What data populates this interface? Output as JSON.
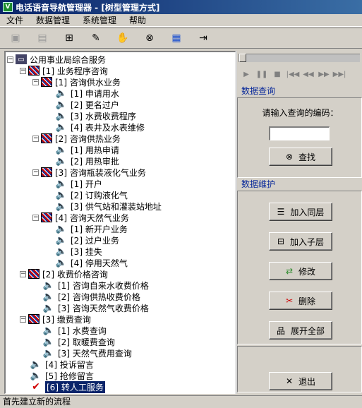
{
  "window": {
    "title": "电话语音导航管理器 - [树型管理方式]"
  },
  "menu": [
    {
      "label": "文件"
    },
    {
      "label": "数据管理"
    },
    {
      "label": "系统管理"
    },
    {
      "label": "帮助"
    }
  ],
  "toolbar": {
    "icons": [
      "save-icon",
      "copy-icon",
      "tree-icon",
      "edit-icon",
      "hand-icon",
      "binoculars-icon",
      "grid-icon",
      "exit-icon"
    ]
  },
  "tree": {
    "root": "公用事业局综合服务",
    "n1": "[1] 业务程序咨询",
    "n1_1": "[1] 咨询供水业务",
    "n1_1_1": "[1] 申请用水",
    "n1_1_2": "[2] 更名过户",
    "n1_1_3": "[3] 水费收费程序",
    "n1_1_4": "[4] 表井及水表维修",
    "n1_2": "[2] 咨询供热业务",
    "n1_2_1": "[1] 用热申请",
    "n1_2_2": "[2] 用热审批",
    "n1_3": "[3] 咨询瓶装液化气业务",
    "n1_3_1": "[1] 开户",
    "n1_3_2": "[2] 订购液化气",
    "n1_3_3": "[3] 供气站和灌装站地址",
    "n1_4": "[4] 咨询天然气业务",
    "n1_4_1": "[1] 新开户业务",
    "n1_4_2": "[2] 过户业务",
    "n1_4_3": "[3] 挂失",
    "n1_4_4": "[4] 停用天然气",
    "n2": "[2] 收费价格咨询",
    "n2_1": "[1] 咨询自来水收费价格",
    "n2_2": "[2] 咨询供热收费价格",
    "n2_3": "[3] 咨询天然气收费价格",
    "n3": "[3] 缴费查询",
    "n3_1": "[1] 水费查询",
    "n3_2": "[2] 取暖费查询",
    "n3_3": "[3] 天然气费用查询",
    "n4": "[4] 投诉留言",
    "n5": "[5] 抢修留言",
    "n6": "[6] 转人工服务"
  },
  "query": {
    "section_title": "数据查询",
    "prompt": "请输入查询的编码：",
    "input_value": "",
    "find_label": "查找"
  },
  "maintain": {
    "section_title": "数据维护",
    "add_sibling": "加入同层",
    "add_child": "加入子层",
    "modify": "修改",
    "delete": "删除",
    "expand_all": "展开全部"
  },
  "exit_label": "退出",
  "status": "首先建立新的流程"
}
